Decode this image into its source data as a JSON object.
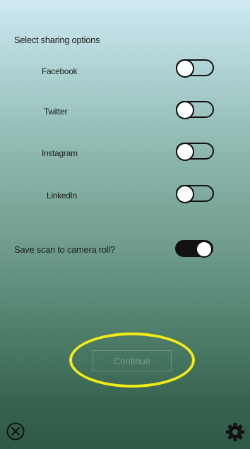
{
  "heading": "Select sharing options",
  "sharing_options": [
    {
      "label": "Facebook",
      "enabled": false
    },
    {
      "label": "Twitter",
      "enabled": false
    },
    {
      "label": "Instagram",
      "enabled": false
    },
    {
      "label": "LinkedIn",
      "enabled": false
    }
  ],
  "save_scan": {
    "label": "Save scan to camera roll?",
    "enabled": true
  },
  "continue_label": "Continue",
  "icons": {
    "close": "close-icon",
    "settings": "gear-icon"
  },
  "colors": {
    "highlight": "#f2ea17",
    "toggle_on": "#111111"
  }
}
